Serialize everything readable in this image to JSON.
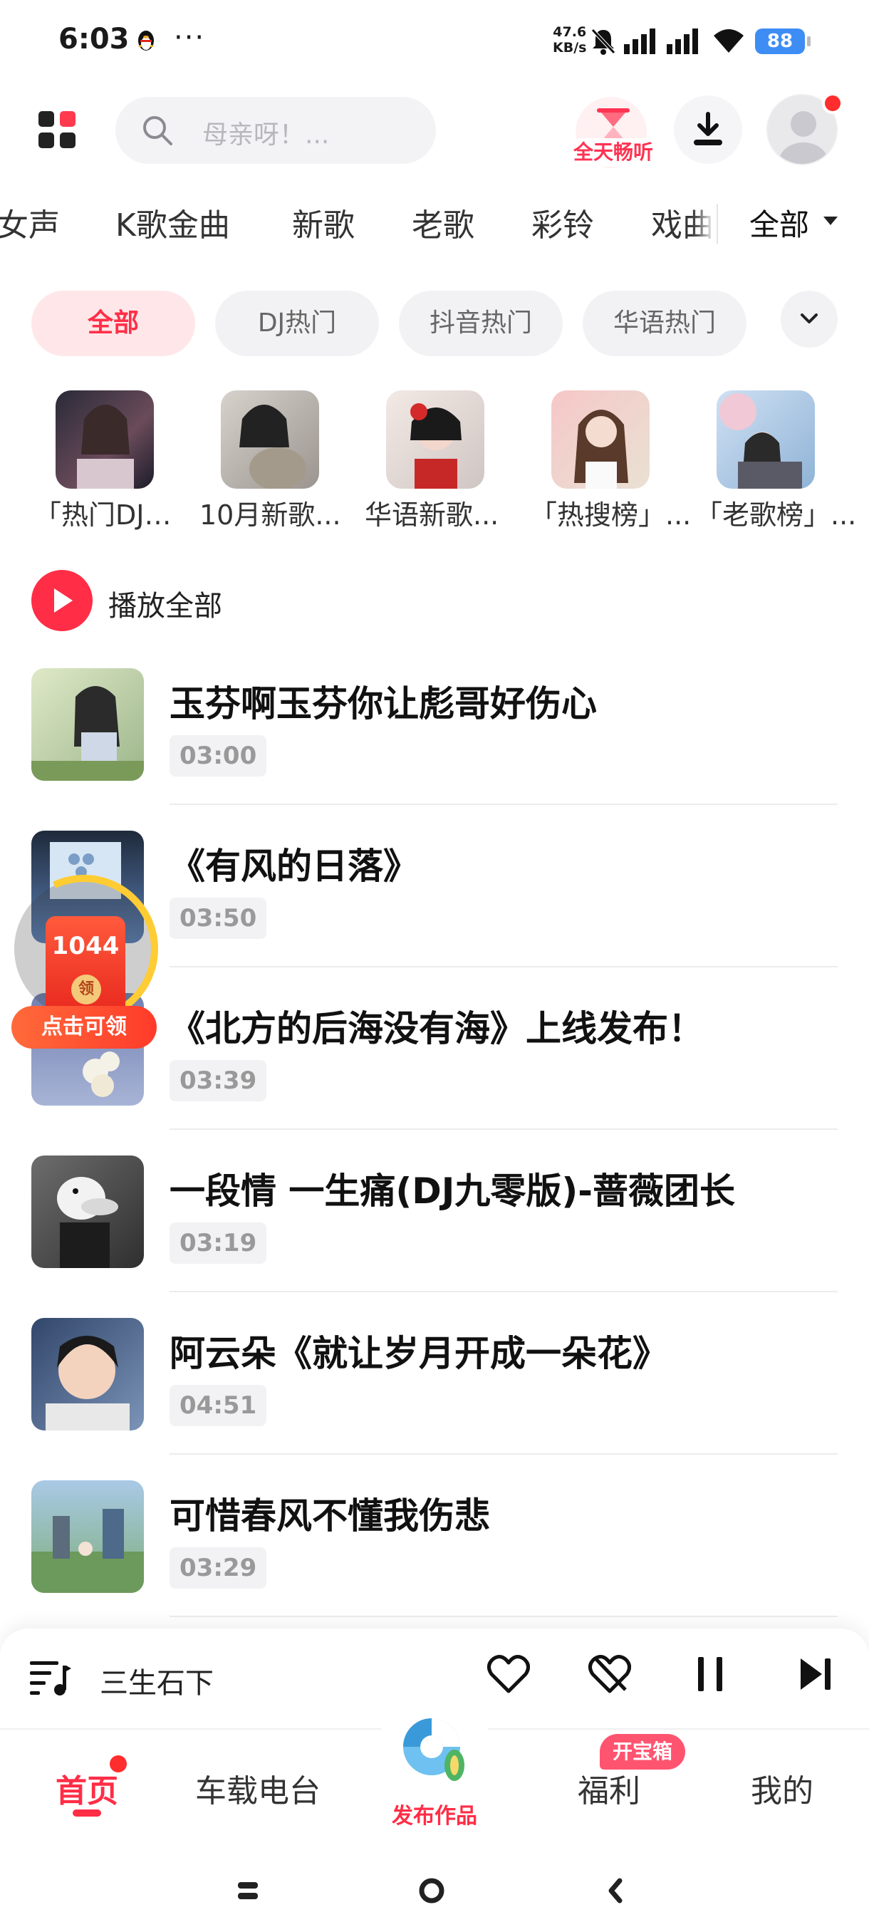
{
  "status_bar": {
    "time": "6:03",
    "dots": "···",
    "net_speed_value": "47.6",
    "net_speed_unit": "KB/s",
    "battery": "88"
  },
  "header": {
    "search_placeholder": "母亲呀！...",
    "vip_label": "全天畅听"
  },
  "categories": [
    "女声",
    "K歌金曲",
    "新歌",
    "老歌",
    "彩铃",
    "戏曲"
  ],
  "category_all": "全部",
  "filters": [
    "全部",
    "DJ热门",
    "抖音热门",
    "华语热门"
  ],
  "playlists": [
    {
      "name": "「热门DJ」..."
    },
    {
      "name": "10月新歌..."
    },
    {
      "name": "华语新歌..."
    },
    {
      "name": "「热搜榜」..."
    },
    {
      "name": "「老歌榜」..."
    }
  ],
  "play_all_label": "播放全部",
  "songs": [
    {
      "title": "玉芬啊玉芬你让彪哥好伤心",
      "duration": "03:00"
    },
    {
      "title": "《有风的日落》",
      "duration": "03:50"
    },
    {
      "title": "《北方的后海没有海》上线发布！",
      "duration": "03:39"
    },
    {
      "title": "一段情 一生痛(DJ九零版)-蔷薇团长",
      "duration": "03:19"
    },
    {
      "title": "阿云朵《就让岁月开成一朵花》",
      "duration": "04:51"
    },
    {
      "title": "可惜春风不懂我伤悲",
      "duration": "03:29"
    }
  ],
  "coupon": {
    "amount": "1044",
    "seal": "领",
    "button": "点击可领"
  },
  "now_playing": {
    "title": "三生石下"
  },
  "bottom_nav": {
    "home": "首页",
    "radio": "车载电台",
    "publish": "发布作品",
    "welfare": "福利",
    "welfare_badge": "开宝箱",
    "mine": "我的"
  },
  "colors": {
    "accent": "#ff2d46",
    "chip_active_bg": "#ffe7e9",
    "battery": "#3d8df5"
  }
}
